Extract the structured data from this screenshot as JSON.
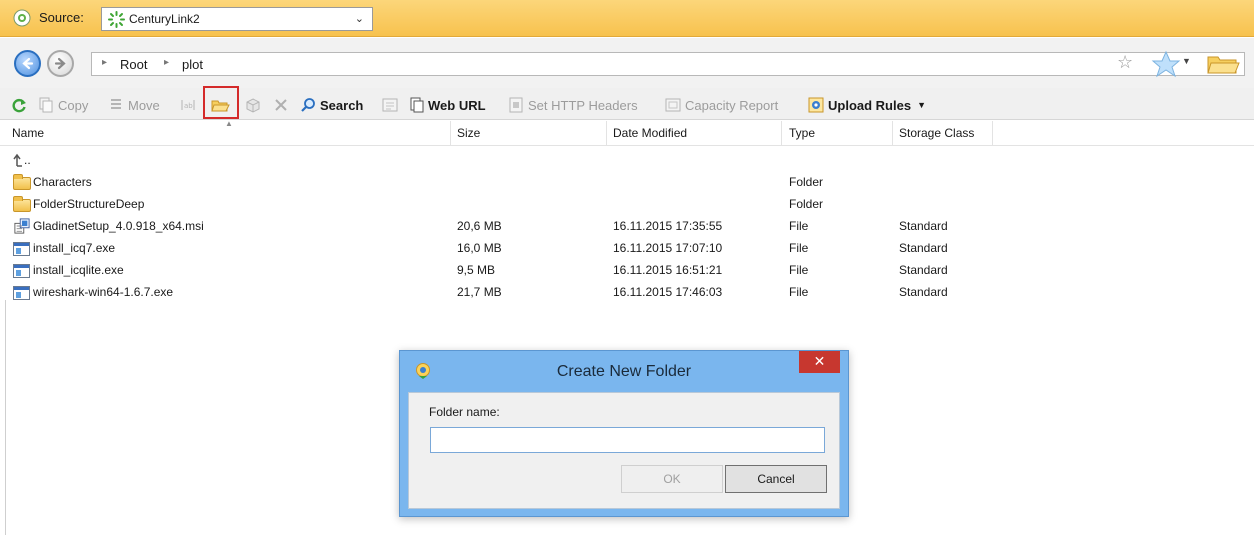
{
  "source": {
    "label": "Source:",
    "selected": "CenturyLink2"
  },
  "breadcrumb": [
    "Root",
    "plot"
  ],
  "toolbar": {
    "copy": "Copy",
    "move": "Move",
    "search": "Search",
    "web_url": "Web URL",
    "set_http_headers": "Set HTTP Headers",
    "capacity_report": "Capacity Report",
    "upload_rules": "Upload Rules"
  },
  "columns": {
    "name": "Name",
    "size": "Size",
    "date": "Date Modified",
    "type": "Type",
    "storage": "Storage Class"
  },
  "rows": [
    {
      "name": "..",
      "size": "",
      "date": "",
      "type": "",
      "storage": "",
      "icon": "up-arrow-icon"
    },
    {
      "name": "Characters",
      "size": "",
      "date": "",
      "type": "Folder",
      "storage": "",
      "icon": "folder-icon"
    },
    {
      "name": "FolderStructureDeep",
      "size": "",
      "date": "",
      "type": "Folder",
      "storage": "",
      "icon": "folder-icon"
    },
    {
      "name": "GladinetSetup_4.0.918_x64.msi",
      "size": "20,6 MB",
      "date": "16.11.2015 17:35:55",
      "type": "File",
      "storage": "Standard",
      "icon": "msi-icon"
    },
    {
      "name": "install_icq7.exe",
      "size": "16,0 MB",
      "date": "16.11.2015 17:07:10",
      "type": "File",
      "storage": "Standard",
      "icon": "exe-icon"
    },
    {
      "name": "install_icqlite.exe",
      "size": "9,5 MB",
      "date": "16.11.2015 16:51:21",
      "type": "File",
      "storage": "Standard",
      "icon": "exe-icon"
    },
    {
      "name": "wireshark-win64-1.6.7.exe",
      "size": "21,7 MB",
      "date": "16.11.2015 17:46:03",
      "type": "File",
      "storage": "Standard",
      "icon": "exe-icon"
    }
  ],
  "dialog": {
    "title": "Create New Folder",
    "close": "✕",
    "field_label": "Folder name:",
    "field_value": "",
    "ok": "OK",
    "cancel": "Cancel"
  },
  "colors": {
    "source_bar": "#f7c24e",
    "dialog_frame": "#7ab6ee",
    "close_button": "#c7372f",
    "highlight": "#d42a2a"
  }
}
